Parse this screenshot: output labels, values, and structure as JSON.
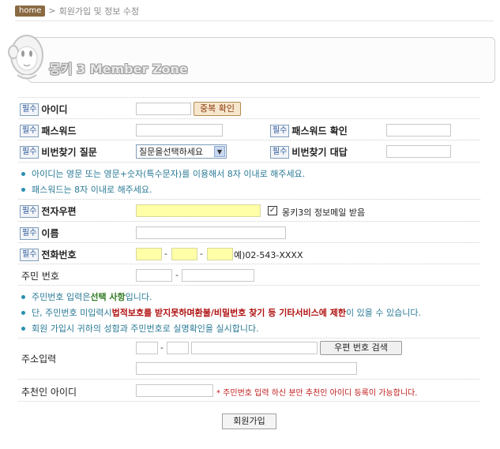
{
  "breadcrumb": {
    "home": "home",
    "path": "회원가입 및 정보 수정"
  },
  "header": {
    "title": "몽키 3 Member Zone"
  },
  "required_tag": "필수",
  "form": {
    "id_label": "아이디",
    "id_check_button": "중복 확인",
    "password_label": "패스워드",
    "password_confirm_label": "패스워드 확인",
    "question_label": "비번찾기 질문",
    "question_select": "질문을선택하세요",
    "answer_label": "비번찾기 대답",
    "email_label": "전자우편",
    "email_opt_in": "몽키3의 정보메일 받음",
    "email_opt_in_checked": true,
    "name_label": "이름",
    "phone_label": "전화번호",
    "phone_dash": "-",
    "phone_example": "예)02-543-XXXX",
    "ssn_label": "주민 번호",
    "address_label": "주소입력",
    "zip_search_button": "우편 번호 검색",
    "referrer_label": "추천인 아이디",
    "referrer_note": "* 주민번호 입력 하신 분만 추천인 아이디 등록이 가능합니다.",
    "submit_button": "회원가입"
  },
  "notes": {
    "id_rule": "아이디는 영문 또는 영문+숫자(특수문자)를 이용해서 8자 이내로 해주세요.",
    "pw_rule": "패스워드는 8자 이내로 해주세요.",
    "ssn1_pre": "주민번호 입력은 ",
    "ssn1_em": "선택 사항",
    "ssn1_post": "입니다.",
    "ssn2_pre": "단, 주민번호 미입력시 ",
    "ssn2_em1": "법적보호를 받지못하며",
    "ssn2_mid": " ",
    "ssn2_em2": "환불/비밀번호 찾기 등 기타서비스에 제한",
    "ssn2_post": "이 있을 수 있습니다.",
    "ssn3": "회원 가입시 귀하의 성함과 주민번호로 실명확인을 실시합니다."
  }
}
